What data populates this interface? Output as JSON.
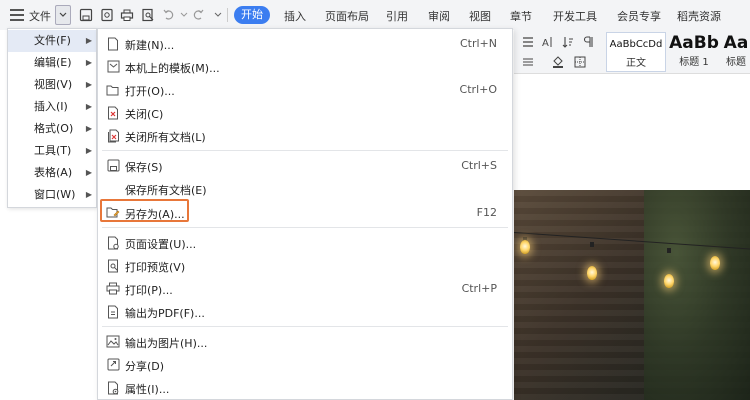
{
  "toolbar": {
    "file_label": "文件",
    "tabs": [
      "插入",
      "页面布局",
      "引用",
      "审阅",
      "视图",
      "章节",
      "开发工具",
      "会员专享",
      "稻壳资源"
    ],
    "active_tab": "开始"
  },
  "styles": [
    {
      "preview": "AaBbCcDd",
      "name": "正文"
    },
    {
      "preview": "AaBb",
      "name": "标题 1"
    },
    {
      "preview": "Aa",
      "name": "标题"
    }
  ],
  "left_menu": [
    {
      "label": "文件(F)"
    },
    {
      "label": "编辑(E)"
    },
    {
      "label": "视图(V)"
    },
    {
      "label": "插入(I)"
    },
    {
      "label": "格式(O)"
    },
    {
      "label": "工具(T)"
    },
    {
      "label": "表格(A)"
    },
    {
      "label": "窗口(W)"
    }
  ],
  "file_menu": [
    {
      "label": "新建(N)...",
      "shortcut": "Ctrl+N",
      "icon": "new-doc-icon"
    },
    {
      "label": "本机上的模板(M)...",
      "shortcut": "",
      "icon": "template-icon"
    },
    {
      "label": "打开(O)...",
      "shortcut": "Ctrl+O",
      "icon": "folder-open-icon"
    },
    {
      "label": "关闭(C)",
      "shortcut": "",
      "icon": "close-doc-icon"
    },
    {
      "label": "关闭所有文档(L)",
      "shortcut": "",
      "icon": "close-all-icon"
    },
    {
      "label": "保存(S)",
      "shortcut": "Ctrl+S",
      "icon": "save-icon"
    },
    {
      "label": "保存所有文档(E)",
      "shortcut": "",
      "icon": ""
    },
    {
      "label": "另存为(A)...",
      "shortcut": "F12",
      "icon": "save-as-icon"
    },
    {
      "label": "页面设置(U)...",
      "shortcut": "",
      "icon": "page-setup-icon"
    },
    {
      "label": "打印预览(V)",
      "shortcut": "",
      "icon": "print-preview-icon"
    },
    {
      "label": "打印(P)...",
      "shortcut": "Ctrl+P",
      "icon": "printer-icon"
    },
    {
      "label": "输出为PDF(F)...",
      "shortcut": "",
      "icon": "pdf-icon"
    },
    {
      "label": "输出为图片(H)...",
      "shortcut": "",
      "icon": "image-export-icon"
    },
    {
      "label": "分享(D)",
      "shortcut": "",
      "icon": "share-icon"
    },
    {
      "label": "属性(I)...",
      "shortcut": "",
      "icon": "properties-icon"
    }
  ],
  "colors": {
    "accent": "#3b7df0",
    "highlight_border": "#e8773a",
    "menu_selected": "#e4eaf5"
  }
}
